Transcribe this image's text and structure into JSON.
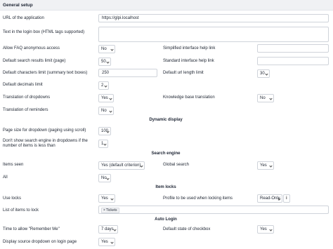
{
  "header": {
    "title": "General setup"
  },
  "general": {
    "url_label": "URL of the application",
    "url_value": "https://glpi.localhost",
    "login_text_label": "Text in the login box (HTML tags supported)",
    "faq_label": "Allow FAQ anonymous access",
    "faq_value": "No",
    "simplified_help_label": "Simplified interface help link",
    "search_limit_label": "Default search results limit (page)",
    "search_limit_value": "50",
    "standard_help_label": "Standard interface help link",
    "char_limit_label": "Default characters limit (summary text boxes)",
    "char_limit_value": "250",
    "url_length_label": "Default url length limit",
    "url_length_value": "30",
    "decimals_label": "Default decimals limit",
    "decimals_value": "2",
    "dropdown_translation_label": "Translation of dropdowns",
    "dropdown_translation_value": "Yes",
    "kb_translation_label": "Knowledge base translation",
    "kb_translation_value": "No",
    "reminder_translation_label": "Translation of reminders",
    "reminder_translation_value": "No"
  },
  "dynamic_display": {
    "title": "Dynamic display",
    "page_size_label": "Page size for dropdown (paging using scroll)",
    "page_size_value": "100",
    "hide_search_label": "Don't show search engine in dropdowns if the number of items is less than",
    "hide_search_value": "1"
  },
  "search_engine": {
    "title": "Search engine",
    "items_seen_label": "Items seen",
    "items_seen_value": "Yes (default criterion)",
    "global_search_label": "Global search",
    "global_search_value": "Yes",
    "all_label": "All",
    "all_value": "No"
  },
  "item_locks": {
    "title": "Item locks",
    "use_locks_label": "Use locks",
    "use_locks_value": "Yes",
    "profile_label": "Profile to be used when locking items",
    "profile_value": "Read-Only",
    "info_icon": "i",
    "items_to_lock_label": "List of items to lock",
    "items_to_lock_tag": "Tickets",
    "tag_remove": "×"
  },
  "auto_login": {
    "title": "Auto Login",
    "remember_label": "Time to allow \"Remember Me\"",
    "remember_value": "7 days",
    "checkbox_default_label": "Default state of checkbox",
    "checkbox_default_value": "Yes",
    "source_dropdown_label": "Display source dropdown on login page",
    "source_dropdown_value": "Yes"
  }
}
